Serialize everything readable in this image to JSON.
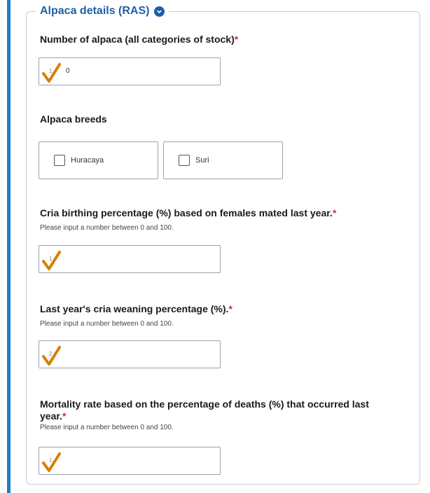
{
  "section": {
    "title": "Alpaca details (RAS)",
    "accent_color": "#1f7fc6",
    "title_color": "#2060a8",
    "required_color": "#c0392b"
  },
  "fields": {
    "alpaca_count": {
      "label": "Number of alpaca (all categories of stock)",
      "required": "*",
      "value": "0",
      "overlay_mark": "1"
    },
    "breeds": {
      "label": "Alpaca breeds",
      "options": [
        {
          "label": "Huracaya",
          "checked": false
        },
        {
          "label": "Suri",
          "checked": false
        }
      ]
    },
    "cria_birthing": {
      "label": "Cria birthing percentage (%) based on females mated last year.",
      "required": "*",
      "hint": "Please input a number between 0 and 100.",
      "value": "",
      "overlay_mark": "1"
    },
    "cria_weaning": {
      "label": "Last year's cria weaning percentage (%).",
      "required": "*",
      "hint": "Please input a number between 0 and 100.",
      "value": "",
      "overlay_mark": "2"
    },
    "mortality": {
      "label_line1": "Mortality rate based on the percentage of deaths (%) that occurred last",
      "label_line2": "year.",
      "required": "*",
      "hint": "Please input a number between 0 and 100.",
      "value": "",
      "overlay_mark": "1"
    }
  },
  "icons": {
    "info": "chevron-down-circle-icon",
    "check": "checkmark-icon"
  }
}
